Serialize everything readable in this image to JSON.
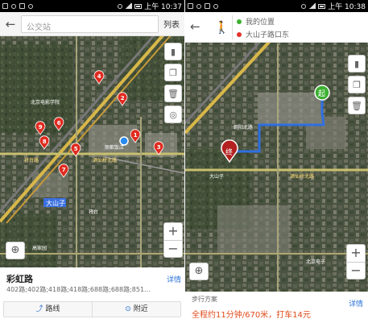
{
  "left": {
    "status_time": "上午 10:37",
    "search_placeholder": "公交站",
    "list_button": "列表",
    "map_label": "大山子",
    "map_pins": [
      "1",
      "2",
      "3",
      "4",
      "5",
      "6",
      "7",
      "8",
      "9"
    ],
    "card_title": "彩虹路",
    "card_subtitle": "402路;402路;418路;418路;688路;688路;851...",
    "detail_link": "详情",
    "route_button": "路线",
    "nearby_button": "附近"
  },
  "right": {
    "status_time": "上午 10:38",
    "start_label": "我的位置",
    "end_label": "大山子路口东",
    "start_color": "#3cb031",
    "end_color": "#e0342a",
    "start_marker": "起",
    "end_marker": "终",
    "plan_title": "步行方案",
    "plan_detail": "全程约11分钟/670米，打车14元",
    "detail_link": "详情"
  },
  "controls": {
    "zoom_in": "+",
    "zoom_out": "−"
  },
  "icons": {
    "back": "back-arrow-icon",
    "walk": "walking-person-icon",
    "layers": "layers-icon",
    "trash": "trash-icon",
    "compass": "compass-icon",
    "locate": "locate-icon"
  }
}
